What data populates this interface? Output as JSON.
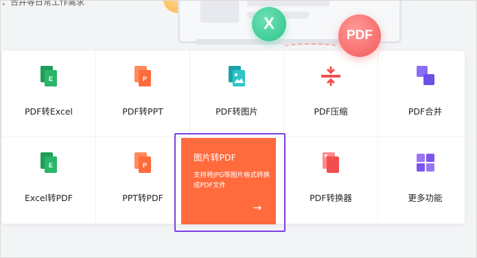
{
  "hero": {
    "caption": "、合并等日常工作需求",
    "badge_x": "X",
    "badge_pdf": "PDF"
  },
  "tools": [
    {
      "label": "PDF转Excel",
      "icon": "excel-doc-icon",
      "color": "#1f9d57"
    },
    {
      "label": "PDF转PPT",
      "icon": "ppt-doc-icon",
      "color": "#ff6b3d"
    },
    {
      "label": "PDF转图片",
      "icon": "image-doc-icon",
      "color": "#23b3b6"
    },
    {
      "label": "PDF压缩",
      "icon": "compress-icon",
      "color": "#f24e4e"
    },
    {
      "label": "PDF合并",
      "icon": "merge-icon",
      "color": "#7b5cf0"
    },
    {
      "label": "Excel转PDF",
      "icon": "excel-doc-icon",
      "color": "#1f9d57"
    },
    {
      "label": "PPT转PDF",
      "icon": "ppt-doc-icon",
      "color": "#ff6b3d"
    },
    {
      "label": "PDF转换器",
      "icon": "converter-icon",
      "color": "#f24e4e"
    },
    {
      "label": "更多功能",
      "icon": "more-grid-icon",
      "color": "#8a5cf0"
    }
  ],
  "feature": {
    "title": "图片转PDF",
    "description": "支持将JPG等图片格式转换成PDF文件",
    "arrow": "→",
    "color": "#ff6b3d"
  },
  "icon_letters": {
    "excel": "E",
    "ppt": "P"
  }
}
